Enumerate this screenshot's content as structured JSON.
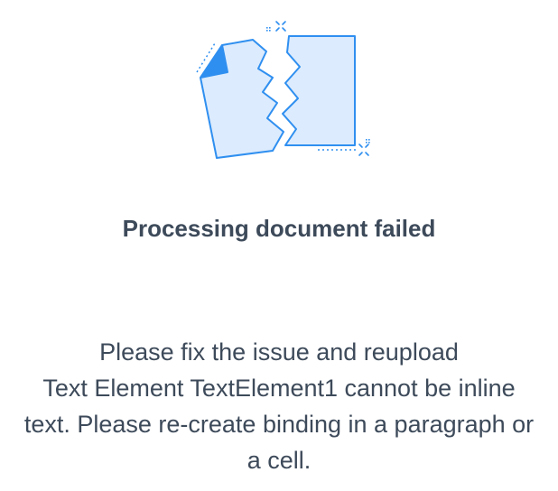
{
  "error": {
    "title": "Processing document failed",
    "message_lines": [
      "Please fix the issue and reupload",
      "Text Element TextElement1 cannot be inline",
      "text. Please re-create binding in a paragraph or",
      "a cell."
    ]
  },
  "illustration": {
    "icon": "torn-document-icon",
    "accent_color": "#2f8ff0",
    "fill_color": "#dcebfd"
  }
}
